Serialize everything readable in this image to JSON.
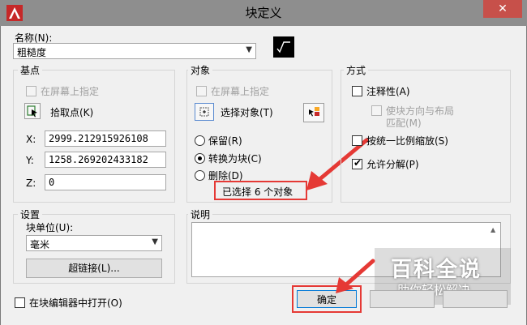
{
  "window": {
    "title": "块定义",
    "close_glyph": "✕"
  },
  "name": {
    "label": "名称(N):",
    "value": "粗糙度",
    "preview_text": "√"
  },
  "base_point": {
    "title": "基点",
    "specify_on_screen": "在屏幕上指定",
    "pick_point": "拾取点(K)",
    "x_label": "X:",
    "x_value": "2999.212915926108",
    "y_label": "Y:",
    "y_value": "1258.269202433182",
    "z_label": "Z:",
    "z_value": "0"
  },
  "objects": {
    "title": "对象",
    "specify_on_screen": "在屏幕上指定",
    "select_objects": "选择对象(T)",
    "retain": "保留(R)",
    "convert_to_block": "转换为块(C)",
    "delete": "删除(D)",
    "selected_count": "已选择 6 个对象"
  },
  "behavior": {
    "title": "方式",
    "annotative": "注释性(A)",
    "match_orientation_line1": "使块方向与布局",
    "match_orientation_line2": "匹配(M)",
    "scale_uniformly": "按统一比例缩放(S)",
    "allow_exploding": "允许分解(P)"
  },
  "settings": {
    "title": "设置",
    "block_unit_label": "块单位(U):",
    "block_unit_value": "毫米",
    "hyperlink": "超链接(L)..."
  },
  "description": {
    "title": "说明"
  },
  "footer": {
    "open_in_editor": "在块编辑器中打开(O)",
    "ok": "确定"
  },
  "watermark": {
    "main": "百科全说",
    "sub": "助你轻松解决"
  },
  "colors": {
    "annotation_red": "#e53935",
    "titlebar": "#8e8e8e",
    "close": "#c7504a"
  }
}
